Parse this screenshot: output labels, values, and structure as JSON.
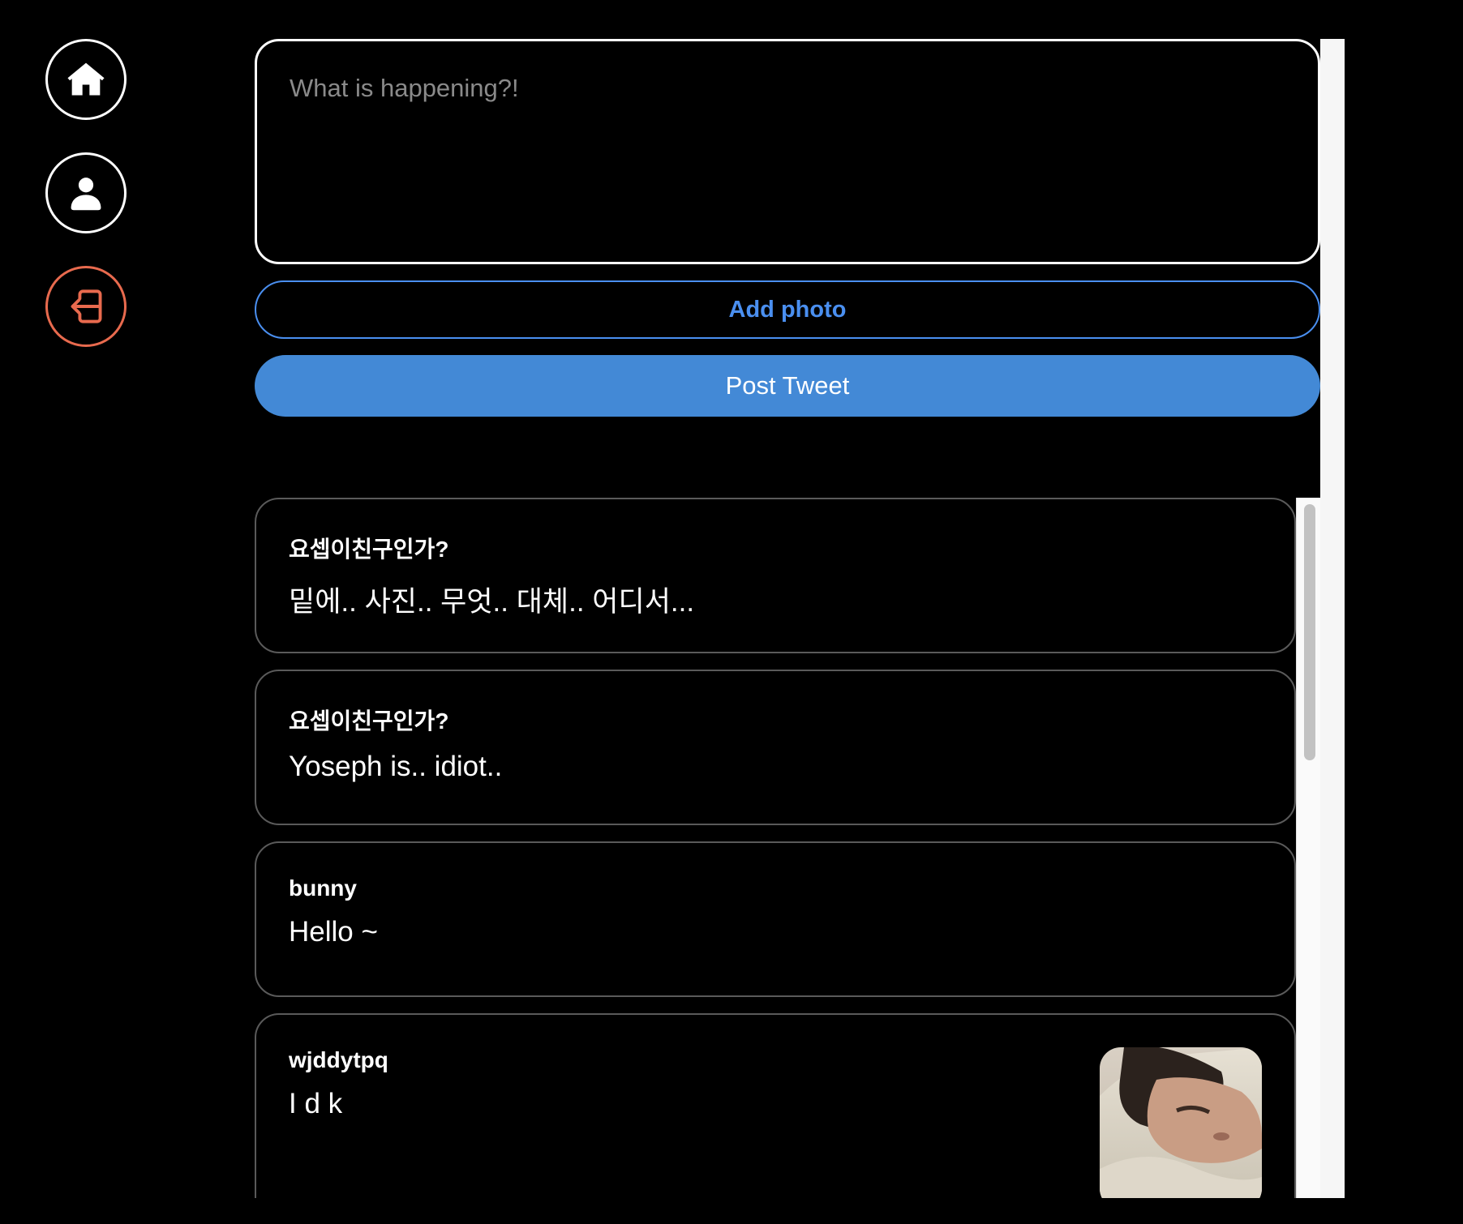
{
  "sidebar": {
    "icons": [
      "home-icon",
      "user-icon",
      "logout-icon"
    ],
    "logout_color": "#e86a4e"
  },
  "composer": {
    "placeholder": "What is happening?!",
    "add_photo_label": "Add photo",
    "post_label": "Post Tweet"
  },
  "colors": {
    "accent": "#4389d6",
    "add_photo": "#4a8ff0",
    "background": "#000000"
  },
  "tweets": [
    {
      "username": "요셉이친구인가?",
      "payload": "밑에.. 사진.. 무엇.. 대체.. 어디서..."
    },
    {
      "username": "요셉이친구인가?",
      "payload": "Yoseph is.. idiot.."
    },
    {
      "username": "bunny",
      "payload": "Hello ~"
    },
    {
      "username": "wjddytpq",
      "payload": "I d k",
      "has_photo": true
    }
  ]
}
